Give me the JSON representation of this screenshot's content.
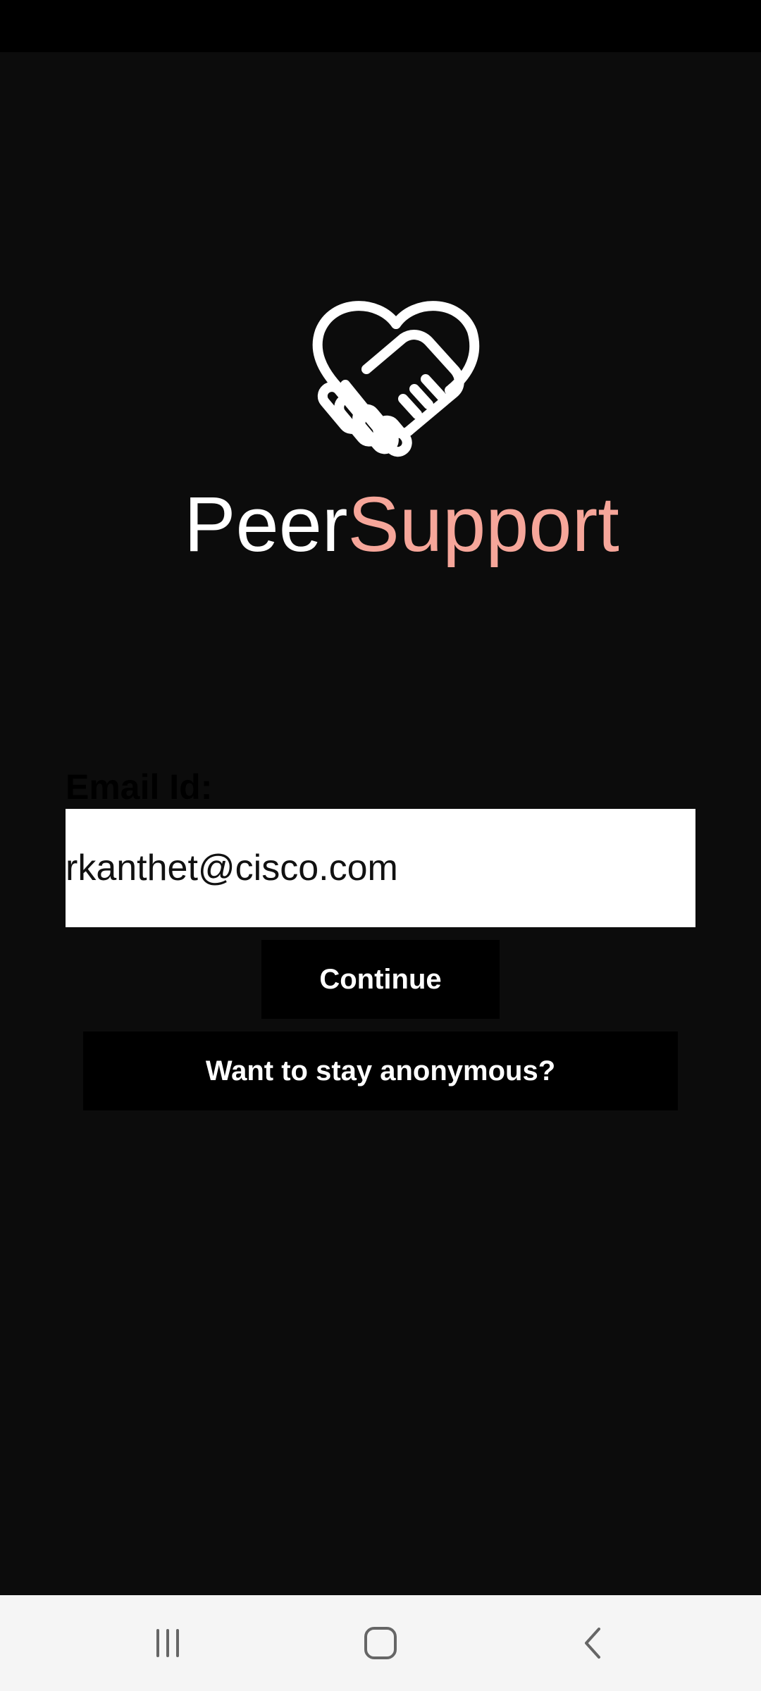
{
  "app": {
    "title_part1": "Peer",
    "title_part2": "Support",
    "logo_icon": "heart-handshake-icon"
  },
  "form": {
    "email_label": "Email Id:",
    "email_value": "rkanthet@cisco.com",
    "continue_label": "Continue",
    "anonymous_label": "Want to stay anonymous?"
  },
  "navigation": {
    "recents_icon": "recents-icon",
    "home_icon": "home-icon",
    "back_icon": "back-icon"
  },
  "colors": {
    "background": "#0c0c0c",
    "accent": "#f6a69a",
    "button_bg": "#000000",
    "input_bg": "#ffffff",
    "nav_bg": "#f5f5f5"
  }
}
